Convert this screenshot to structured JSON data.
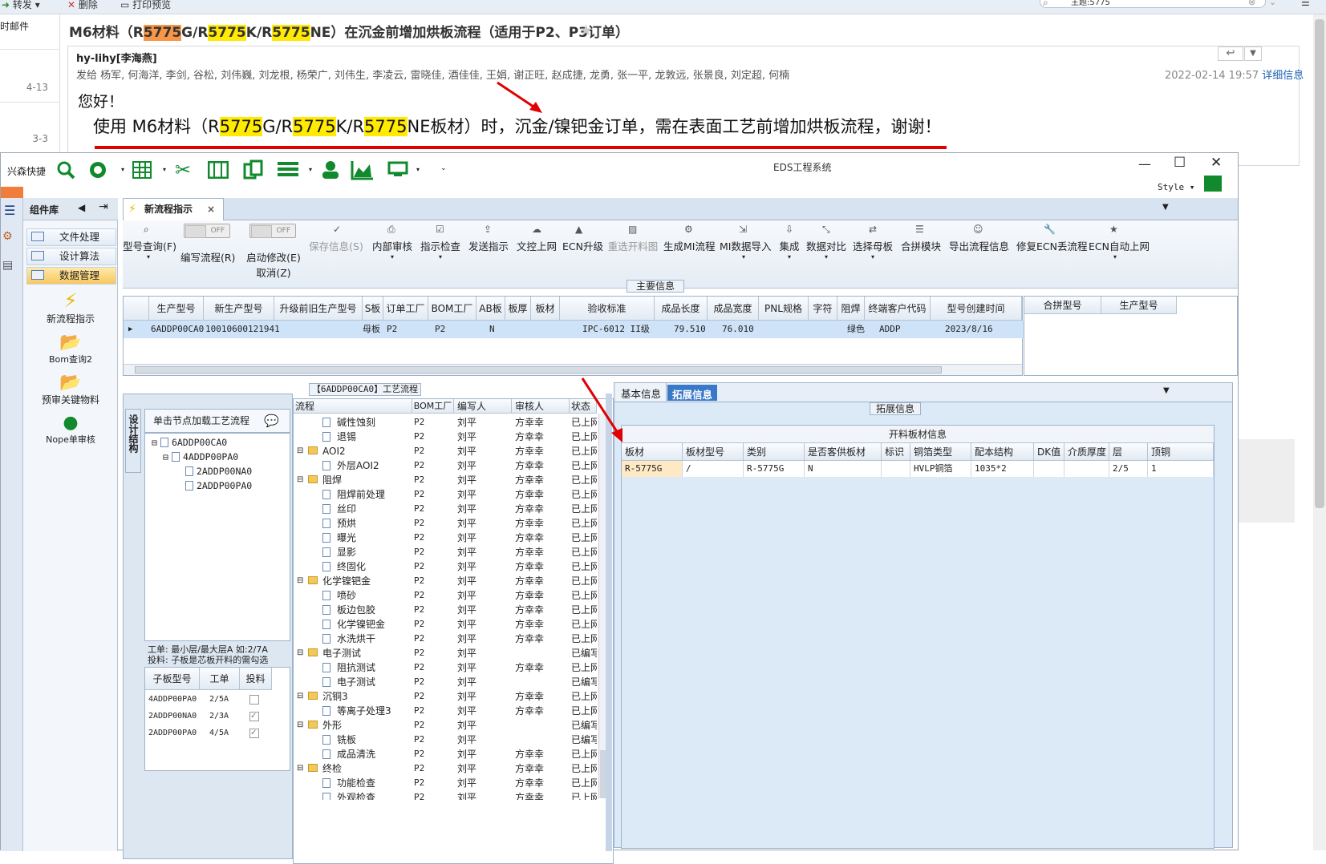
{
  "mail": {
    "toolbar": {
      "forward": "转发",
      "delete": "删除",
      "print": "打印预览",
      "search_value": "主题:5775"
    },
    "left_list": [
      {
        "label": "时邮件"
      },
      {
        "label": "4-13"
      },
      {
        "label": "3-3"
      }
    ],
    "subject_parts": [
      {
        "text": "M6材料（R",
        "hl": ""
      },
      {
        "text": "5775",
        "hl": "orange"
      },
      {
        "text": "G/R",
        "hl": ""
      },
      {
        "text": "5775",
        "hl": "yellow"
      },
      {
        "text": "K/R",
        "hl": ""
      },
      {
        "text": "5775",
        "hl": "yellow"
      },
      {
        "text": "NE）在沉金前增加烘板流程（适用于P2、P3订单）",
        "hl": ""
      }
    ],
    "from": "hy-lihy[李海燕]",
    "to": "发给 杨军, 何海洋, 李剑, 谷松, 刘伟巍, 刘龙根, 杨荣广, 刘伟生, 李凌云, 雷晓佳, 酒佳佳, 王娟, 谢正旺, 赵成捷, 龙勇, 张一平, 龙敦远, 张景良, 刘定超, 何楠",
    "date": "2022-02-14 19:57",
    "detail_link": "详细信息",
    "greeting": "您好！",
    "content_parts": [
      {
        "text": "使用 M6材料（R",
        "hl": ""
      },
      {
        "text": "5775",
        "hl": "yellow"
      },
      {
        "text": "G/R",
        "hl": ""
      },
      {
        "text": "5775",
        "hl": "yellow"
      },
      {
        "text": "K/R",
        "hl": ""
      },
      {
        "text": "5775",
        "hl": "yellow"
      },
      {
        "text": "NE板材）时，沉金/镍钯金订单，需在表面工艺前增加烘板流程，谢谢！",
        "hl": ""
      }
    ]
  },
  "eds": {
    "title": "EDS工程系统",
    "quicklaunch": "兴森快捷",
    "style_label": "Style",
    "nav": {
      "header": "组件库",
      "items": [
        "文件处理",
        "设计算法",
        "数据管理"
      ],
      "tools": [
        "新流程指示",
        "Bom查询2",
        "预审关键物料",
        "Nope单审核"
      ]
    },
    "tab": "新流程指示",
    "ribbon": [
      {
        "label": "型号查询(F)",
        "dis": false
      },
      {
        "label": "编写流程(R)",
        "dis": false,
        "toggle": "OFF"
      },
      {
        "label": "启动修改(E)",
        "label2": "取消(Z)",
        "dis": false,
        "toggle": "OFF"
      },
      {
        "label": "保存信息(S)",
        "dis": true
      },
      {
        "label": "内部审核",
        "dis": false
      },
      {
        "label": "指示检查",
        "dis": false
      },
      {
        "label": "发送指示",
        "dis": false
      },
      {
        "label": "文控上网",
        "dis": false
      },
      {
        "label": "ECN升级",
        "dis": false
      },
      {
        "label": "重选开料图",
        "dis": true
      },
      {
        "label": "生成MI流程",
        "dis": false
      },
      {
        "label": "MI数据导入",
        "dis": false
      },
      {
        "label": "集成",
        "dis": false
      },
      {
        "label": "数据对比",
        "dis": false
      },
      {
        "label": "选择母板",
        "dis": false
      },
      {
        "label": "合拼模块",
        "dis": false
      },
      {
        "label": "导出流程信息",
        "dis": false
      },
      {
        "label": "修复ECN丢流程",
        "dis": false
      },
      {
        "label": "ECN自动上网",
        "dis": false
      }
    ],
    "main_info_title": "主要信息",
    "main_grid": {
      "headers": [
        "生产型号",
        "新生产型号",
        "升级前旧生产型号",
        "S板",
        "订单工厂",
        "BOM工厂",
        "AB板",
        "板厚",
        "板材",
        "验收标准",
        "成品长度",
        "成品宽度",
        "PNL规格",
        "字符",
        "阻焊",
        "终端客户代码",
        "型号创建时间"
      ],
      "row": [
        "6ADDP00CA0",
        "10010600121941",
        "",
        "母板",
        "P2",
        "P2",
        "N",
        "",
        "",
        "IPC-6012 II级",
        "79.510",
        "76.010",
        "",
        "",
        "绿色",
        "ADDP",
        "2023/8/16"
      ],
      "side_headers": [
        "合拼型号",
        "生产型号"
      ]
    },
    "process_title": "【6ADDP00CA0】工艺流程",
    "left_panel": {
      "vert_tab": "设计结构",
      "hint": "单击节点加载工艺流程",
      "tree": [
        "6ADDP00CA0",
        "4ADDP00PA0",
        "2ADDP00NA0",
        "2ADDP00PA0"
      ],
      "note1": "工单: 最小层/最大层A 如:2/7A",
      "note2": "投料: 子板是芯板开料的需勾选",
      "sub_headers": [
        "子板型号",
        "工单",
        "投料"
      ],
      "sub_rows": [
        {
          "model": "4ADDP00PA0",
          "order": "2/5A",
          "feed": false
        },
        {
          "model": "2ADDP00NA0",
          "order": "2/3A",
          "feed": true
        },
        {
          "model": "2ADDP00PA0",
          "order": "4/5A",
          "feed": true
        }
      ]
    },
    "flow": {
      "headers": [
        "流程",
        "BOM工厂",
        "编写人",
        "审核人",
        "状态"
      ],
      "rows": [
        {
          "name": "碱性蚀刻",
          "type": "doc",
          "bom": "P2",
          "writer": "刘平",
          "reviewer": "方幸幸",
          "status": "已上网"
        },
        {
          "name": "退锡",
          "type": "doc",
          "bom": "P2",
          "writer": "刘平",
          "reviewer": "方幸幸",
          "status": "已上网"
        },
        {
          "name": "AOI2",
          "type": "folder",
          "bom": "P2",
          "writer": "刘平",
          "reviewer": "方幸幸",
          "status": "已上网"
        },
        {
          "name": "外层AOI2",
          "type": "doc",
          "bom": "P2",
          "writer": "刘平",
          "reviewer": "方幸幸",
          "status": "已上网"
        },
        {
          "name": "阻焊",
          "type": "folder",
          "bom": "P2",
          "writer": "刘平",
          "reviewer": "方幸幸",
          "status": "已上网"
        },
        {
          "name": "阻焊前处理",
          "type": "doc",
          "bom": "P2",
          "writer": "刘平",
          "reviewer": "方幸幸",
          "status": "已上网"
        },
        {
          "name": "丝印",
          "type": "doc",
          "bom": "P2",
          "writer": "刘平",
          "reviewer": "方幸幸",
          "status": "已上网"
        },
        {
          "name": "预烘",
          "type": "doc",
          "bom": "P2",
          "writer": "刘平",
          "reviewer": "方幸幸",
          "status": "已上网"
        },
        {
          "name": "曝光",
          "type": "doc",
          "bom": "P2",
          "writer": "刘平",
          "reviewer": "方幸幸",
          "status": "已上网"
        },
        {
          "name": "显影",
          "type": "doc",
          "bom": "P2",
          "writer": "刘平",
          "reviewer": "方幸幸",
          "status": "已上网"
        },
        {
          "name": "终固化",
          "type": "doc",
          "bom": "P2",
          "writer": "刘平",
          "reviewer": "方幸幸",
          "status": "已上网"
        },
        {
          "name": "化学镍钯金",
          "type": "folder",
          "bom": "P2",
          "writer": "刘平",
          "reviewer": "方幸幸",
          "status": "已上网"
        },
        {
          "name": "喷砂",
          "type": "doc",
          "bom": "P2",
          "writer": "刘平",
          "reviewer": "方幸幸",
          "status": "已上网"
        },
        {
          "name": "板边包胶",
          "type": "doc",
          "bom": "P2",
          "writer": "刘平",
          "reviewer": "方幸幸",
          "status": "已上网"
        },
        {
          "name": "化学镍钯金",
          "type": "doc",
          "bom": "P2",
          "writer": "刘平",
          "reviewer": "方幸幸",
          "status": "已上网"
        },
        {
          "name": "水洗烘干",
          "type": "doc",
          "bom": "P2",
          "writer": "刘平",
          "reviewer": "方幸幸",
          "status": "已上网"
        },
        {
          "name": "电子测试",
          "type": "folder",
          "bom": "P2",
          "writer": "刘平",
          "reviewer": "",
          "status": "已编写"
        },
        {
          "name": "阻抗测试",
          "type": "doc",
          "bom": "P2",
          "writer": "刘平",
          "reviewer": "方幸幸",
          "status": "已上网"
        },
        {
          "name": "电子测试",
          "type": "doc",
          "bom": "P2",
          "writer": "刘平",
          "reviewer": "",
          "status": "已编写"
        },
        {
          "name": "沉铜3",
          "type": "folder",
          "bom": "P2",
          "writer": "刘平",
          "reviewer": "方幸幸",
          "status": "已上网"
        },
        {
          "name": "等离子处理3",
          "type": "doc",
          "bom": "P2",
          "writer": "刘平",
          "reviewer": "方幸幸",
          "status": "已上网"
        },
        {
          "name": "外形",
          "type": "folder",
          "bom": "P2",
          "writer": "刘平",
          "reviewer": "",
          "status": "已编写"
        },
        {
          "name": "铣板",
          "type": "doc",
          "bom": "P2",
          "writer": "刘平",
          "reviewer": "",
          "status": "已编写"
        },
        {
          "name": "成品清洗",
          "type": "doc",
          "bom": "P2",
          "writer": "刘平",
          "reviewer": "方幸幸",
          "status": "已上网"
        },
        {
          "name": "终检",
          "type": "folder",
          "bom": "P2",
          "writer": "刘平",
          "reviewer": "方幸幸",
          "status": "已上网"
        },
        {
          "name": "功能检查",
          "type": "doc",
          "bom": "P2",
          "writer": "刘平",
          "reviewer": "方幸幸",
          "status": "已上网"
        },
        {
          "name": "外观检查",
          "type": "doc",
          "bom": "P2",
          "writer": "刘平",
          "reviewer": "方幸幸",
          "status": "已上网"
        }
      ]
    },
    "right": {
      "tabs": [
        "基本信息",
        "拓展信息"
      ],
      "section": "拓展信息",
      "grid_title": "开料板材信息",
      "headers": [
        "板材",
        "板材型号",
        "类别",
        "是否客供板材",
        "标识",
        "铜箔类型",
        "配本结构",
        "DK值",
        "介质厚度",
        "层",
        "顶铜"
      ],
      "row": [
        "R-5775G",
        "/",
        "R-5775G",
        "N",
        "",
        "HVLP铜箔",
        "1035*2",
        "",
        "",
        "2/5",
        "1"
      ]
    }
  }
}
